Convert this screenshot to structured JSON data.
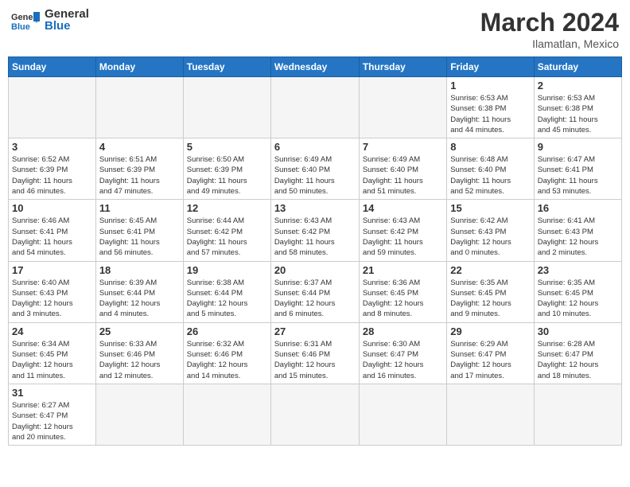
{
  "header": {
    "logo_general": "General",
    "logo_blue": "Blue",
    "month_year": "March 2024",
    "location": "Ilamatlan, Mexico"
  },
  "days_of_week": [
    "Sunday",
    "Monday",
    "Tuesday",
    "Wednesday",
    "Thursday",
    "Friday",
    "Saturday"
  ],
  "weeks": [
    [
      {
        "day": "",
        "info": ""
      },
      {
        "day": "",
        "info": ""
      },
      {
        "day": "",
        "info": ""
      },
      {
        "day": "",
        "info": ""
      },
      {
        "day": "",
        "info": ""
      },
      {
        "day": "1",
        "info": "Sunrise: 6:53 AM\nSunset: 6:38 PM\nDaylight: 11 hours\nand 44 minutes."
      },
      {
        "day": "2",
        "info": "Sunrise: 6:53 AM\nSunset: 6:38 PM\nDaylight: 11 hours\nand 45 minutes."
      }
    ],
    [
      {
        "day": "3",
        "info": "Sunrise: 6:52 AM\nSunset: 6:39 PM\nDaylight: 11 hours\nand 46 minutes."
      },
      {
        "day": "4",
        "info": "Sunrise: 6:51 AM\nSunset: 6:39 PM\nDaylight: 11 hours\nand 47 minutes."
      },
      {
        "day": "5",
        "info": "Sunrise: 6:50 AM\nSunset: 6:39 PM\nDaylight: 11 hours\nand 49 minutes."
      },
      {
        "day": "6",
        "info": "Sunrise: 6:49 AM\nSunset: 6:40 PM\nDaylight: 11 hours\nand 50 minutes."
      },
      {
        "day": "7",
        "info": "Sunrise: 6:49 AM\nSunset: 6:40 PM\nDaylight: 11 hours\nand 51 minutes."
      },
      {
        "day": "8",
        "info": "Sunrise: 6:48 AM\nSunset: 6:40 PM\nDaylight: 11 hours\nand 52 minutes."
      },
      {
        "day": "9",
        "info": "Sunrise: 6:47 AM\nSunset: 6:41 PM\nDaylight: 11 hours\nand 53 minutes."
      }
    ],
    [
      {
        "day": "10",
        "info": "Sunrise: 6:46 AM\nSunset: 6:41 PM\nDaylight: 11 hours\nand 54 minutes."
      },
      {
        "day": "11",
        "info": "Sunrise: 6:45 AM\nSunset: 6:41 PM\nDaylight: 11 hours\nand 56 minutes."
      },
      {
        "day": "12",
        "info": "Sunrise: 6:44 AM\nSunset: 6:42 PM\nDaylight: 11 hours\nand 57 minutes."
      },
      {
        "day": "13",
        "info": "Sunrise: 6:43 AM\nSunset: 6:42 PM\nDaylight: 11 hours\nand 58 minutes."
      },
      {
        "day": "14",
        "info": "Sunrise: 6:43 AM\nSunset: 6:42 PM\nDaylight: 11 hours\nand 59 minutes."
      },
      {
        "day": "15",
        "info": "Sunrise: 6:42 AM\nSunset: 6:43 PM\nDaylight: 12 hours\nand 0 minutes."
      },
      {
        "day": "16",
        "info": "Sunrise: 6:41 AM\nSunset: 6:43 PM\nDaylight: 12 hours\nand 2 minutes."
      }
    ],
    [
      {
        "day": "17",
        "info": "Sunrise: 6:40 AM\nSunset: 6:43 PM\nDaylight: 12 hours\nand 3 minutes."
      },
      {
        "day": "18",
        "info": "Sunrise: 6:39 AM\nSunset: 6:44 PM\nDaylight: 12 hours\nand 4 minutes."
      },
      {
        "day": "19",
        "info": "Sunrise: 6:38 AM\nSunset: 6:44 PM\nDaylight: 12 hours\nand 5 minutes."
      },
      {
        "day": "20",
        "info": "Sunrise: 6:37 AM\nSunset: 6:44 PM\nDaylight: 12 hours\nand 6 minutes."
      },
      {
        "day": "21",
        "info": "Sunrise: 6:36 AM\nSunset: 6:45 PM\nDaylight: 12 hours\nand 8 minutes."
      },
      {
        "day": "22",
        "info": "Sunrise: 6:35 AM\nSunset: 6:45 PM\nDaylight: 12 hours\nand 9 minutes."
      },
      {
        "day": "23",
        "info": "Sunrise: 6:35 AM\nSunset: 6:45 PM\nDaylight: 12 hours\nand 10 minutes."
      }
    ],
    [
      {
        "day": "24",
        "info": "Sunrise: 6:34 AM\nSunset: 6:45 PM\nDaylight: 12 hours\nand 11 minutes."
      },
      {
        "day": "25",
        "info": "Sunrise: 6:33 AM\nSunset: 6:46 PM\nDaylight: 12 hours\nand 12 minutes."
      },
      {
        "day": "26",
        "info": "Sunrise: 6:32 AM\nSunset: 6:46 PM\nDaylight: 12 hours\nand 14 minutes."
      },
      {
        "day": "27",
        "info": "Sunrise: 6:31 AM\nSunset: 6:46 PM\nDaylight: 12 hours\nand 15 minutes."
      },
      {
        "day": "28",
        "info": "Sunrise: 6:30 AM\nSunset: 6:47 PM\nDaylight: 12 hours\nand 16 minutes."
      },
      {
        "day": "29",
        "info": "Sunrise: 6:29 AM\nSunset: 6:47 PM\nDaylight: 12 hours\nand 17 minutes."
      },
      {
        "day": "30",
        "info": "Sunrise: 6:28 AM\nSunset: 6:47 PM\nDaylight: 12 hours\nand 18 minutes."
      }
    ],
    [
      {
        "day": "31",
        "info": "Sunrise: 6:27 AM\nSunset: 6:47 PM\nDaylight: 12 hours\nand 20 minutes."
      },
      {
        "day": "",
        "info": ""
      },
      {
        "day": "",
        "info": ""
      },
      {
        "day": "",
        "info": ""
      },
      {
        "day": "",
        "info": ""
      },
      {
        "day": "",
        "info": ""
      },
      {
        "day": "",
        "info": ""
      }
    ]
  ]
}
